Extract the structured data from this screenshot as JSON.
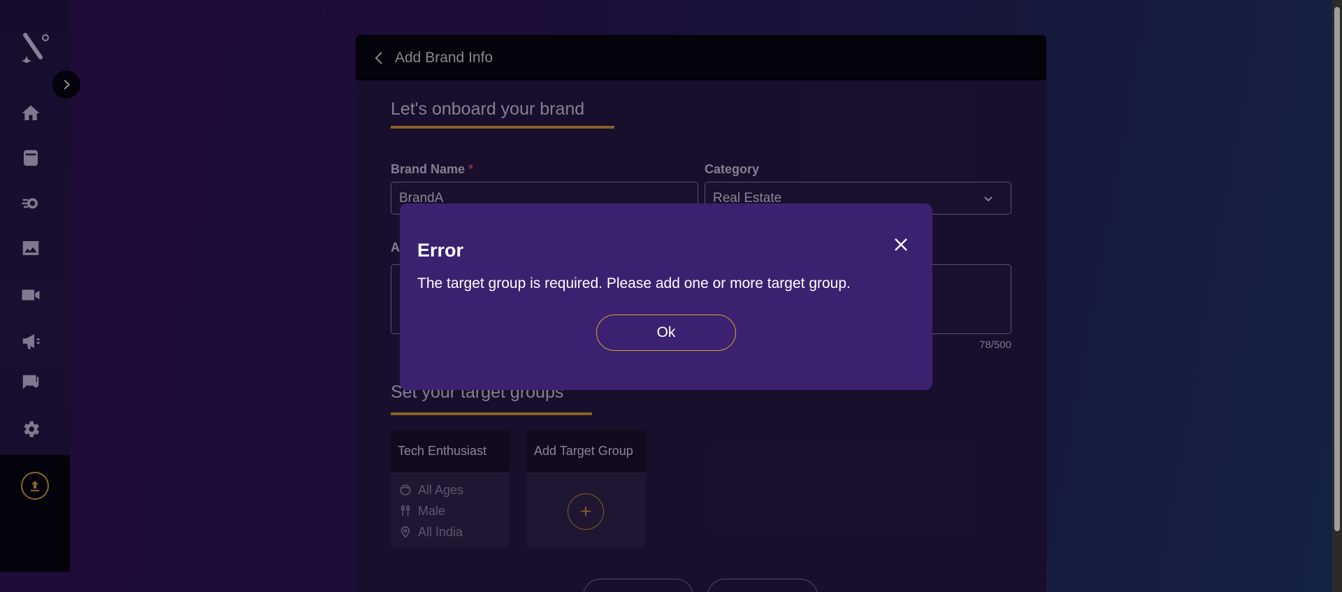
{
  "header": {
    "title": "Add Brand Info"
  },
  "sidebar": {
    "items": [
      {
        "icon": "home-icon"
      },
      {
        "icon": "archive-icon"
      },
      {
        "icon": "automation-gear-icon"
      },
      {
        "icon": "image-icon"
      },
      {
        "icon": "video-camera-icon"
      },
      {
        "icon": "megaphone-icon"
      },
      {
        "icon": "quiz-icon"
      },
      {
        "icon": "settings-gear-icon"
      }
    ],
    "upload_icon": "upload-icon"
  },
  "form": {
    "section_title": "Let's onboard your brand",
    "brand_name_label": "Brand Name",
    "required_mark": "*",
    "brand_name_value": "BrandA",
    "category_label": "Category",
    "category_value": "Real Estate",
    "about_label_fragment": "A",
    "char_counter": "78/500"
  },
  "target_groups": {
    "section_title": "Set your target groups",
    "groups": [
      {
        "name": "Tech Enthusiast",
        "age": "All Ages",
        "gender": "Male",
        "location": "All India"
      }
    ],
    "add_label": "Add Target Group",
    "add_symbol": "+"
  },
  "modal": {
    "title": "Error",
    "message": "The target group is required. Please add one or more target group.",
    "ok_label": "Ok"
  },
  "colors": {
    "accent": "#d4a531",
    "modal_bg": "#3a2270",
    "header_bg": "#000000"
  }
}
